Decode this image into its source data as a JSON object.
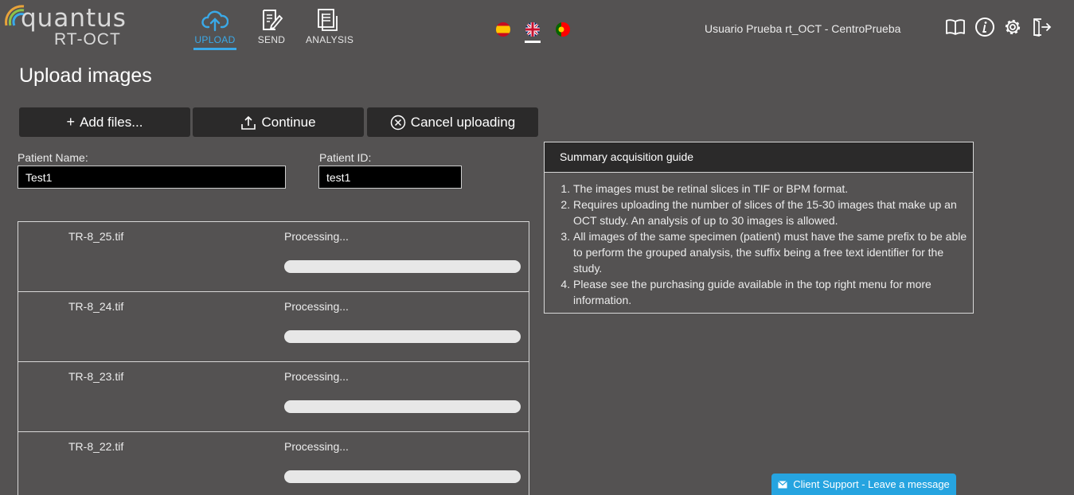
{
  "header": {
    "logo": {
      "name": "quantus",
      "sub": "RT-OCT"
    },
    "nav": [
      {
        "label": "UPLOAD",
        "icon": "cloud-upload-icon",
        "active": true
      },
      {
        "label": "SEND",
        "icon": "document-edit-icon",
        "active": false
      },
      {
        "label": "ANALYSIS",
        "icon": "documents-icon",
        "active": false
      }
    ],
    "languages": [
      "es",
      "en",
      "pt"
    ],
    "active_language": "en",
    "user": "Usuario Prueba rt_OCT - CentroPrueba",
    "icons": [
      "book-icon",
      "info-icon",
      "gear-icon",
      "logout-icon"
    ]
  },
  "page": {
    "title": "Upload images",
    "buttons": {
      "add": "Add files...",
      "continue": "Continue",
      "cancel": "Cancel uploading"
    },
    "patient_name": {
      "label": "Patient Name:",
      "value": "Test1"
    },
    "patient_id": {
      "label": "Patient ID:",
      "value": "test1"
    }
  },
  "files": [
    {
      "name": "TR-8_25.tif",
      "status": "Processing...",
      "progress": 0
    },
    {
      "name": "TR-8_24.tif",
      "status": "Processing...",
      "progress": 0
    },
    {
      "name": "TR-8_23.tif",
      "status": "Processing...",
      "progress": 0
    },
    {
      "name": "TR-8_22.tif",
      "status": "Processing...",
      "progress": 0
    }
  ],
  "guide": {
    "title": "Summary acquisition guide",
    "items": [
      "The images must be retinal slices in TIF or BPM format.",
      "Requires uploading the number of slices of the 15-30 images that make up an OCT study. An analysis of up to 30 images is allowed.",
      "All images of the same specimen (patient) must have the same prefix to be able to perform the grouped analysis, the suffix being a free text identifier for the study.",
      "Please see the purchasing guide available in the top right menu for more information."
    ]
  },
  "support": {
    "label": "Client Support - Leave a message"
  },
  "colors": {
    "background": "#545252",
    "accent": "#3aa9e8",
    "button": "#2b2a2a",
    "support": "#26a4e0"
  }
}
